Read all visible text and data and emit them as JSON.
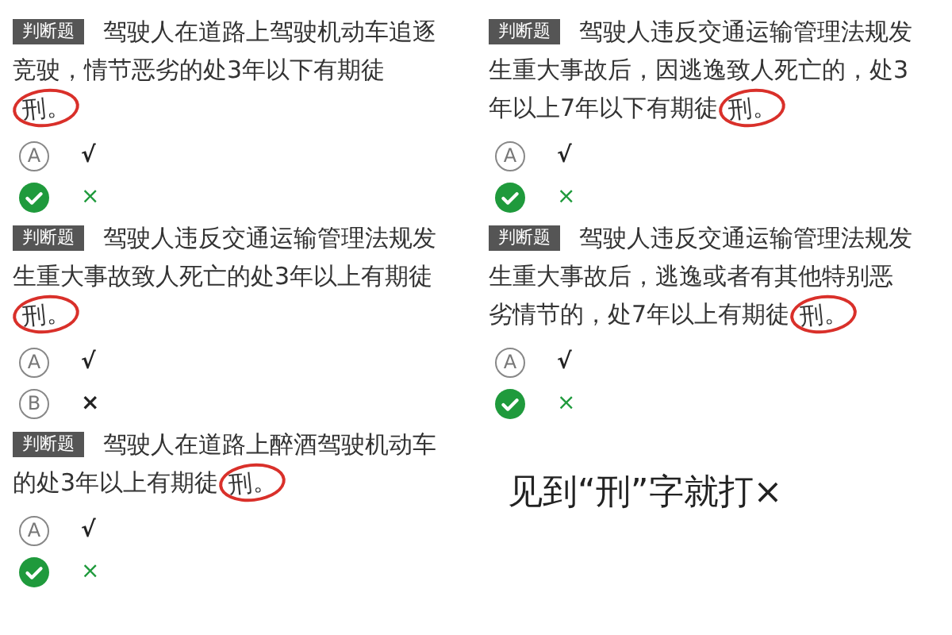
{
  "questions": [
    {
      "tag": "判断题",
      "text": "驾驶人在道路上驾驶机动车追逐竞驶，情节恶劣的处3年以下有期徒",
      "circled": "刑。",
      "options": [
        {
          "letter": "A",
          "label": "√",
          "selected": false
        },
        {
          "label": "×",
          "selected": true
        }
      ]
    },
    {
      "tag": "判断题",
      "text": "驾驶人违反交通运输管理法规发生重大事故后，因逃逸致人死亡的，处3年以上7年以下有期徒",
      "circled": "刑。",
      "options": [
        {
          "letter": "A",
          "label": "√",
          "selected": false
        },
        {
          "label": "×",
          "selected": true
        }
      ]
    },
    {
      "tag": "判断题",
      "text": "驾驶人违反交通运输管理法规发生重大事故致人死亡的处3年以上有期徒",
      "circled": "刑。",
      "options": [
        {
          "letter": "A",
          "label": "√",
          "selected": false
        },
        {
          "letter": "B",
          "label": "×",
          "selected": false
        }
      ]
    },
    {
      "tag": "判断题",
      "text": "驾驶人违反交通运输管理法规发生重大事故后，逃逸或者有其他特别恶劣情节的，处7年以上有期徒",
      "circled": "刑。",
      "options": [
        {
          "letter": "A",
          "label": "√",
          "selected": false
        },
        {
          "label": "×",
          "selected": true
        }
      ]
    },
    {
      "tag": "判断题",
      "text": "驾驶人在道路上醉酒驾驶机动车的处3年以上有期徒",
      "circled": "刑。",
      "options": [
        {
          "letter": "A",
          "label": "√",
          "selected": false
        },
        {
          "label": "×",
          "selected": true
        }
      ]
    }
  ],
  "caption": "见到“刑”字就打×"
}
